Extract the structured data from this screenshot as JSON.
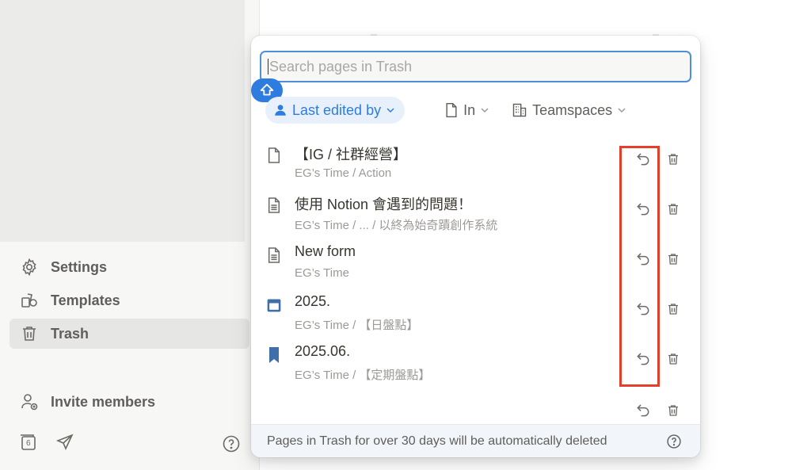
{
  "sidebar": {
    "items": [
      {
        "label": "Settings",
        "icon": "gear-icon"
      },
      {
        "label": "Templates",
        "icon": "templates-icon"
      },
      {
        "label": "Trash",
        "icon": "trash-icon",
        "active": true
      },
      {
        "label": "Invite members",
        "icon": "add-user-icon"
      }
    ],
    "bottom_icons": [
      "calendar-icon",
      "send-icon",
      "help-icon"
    ],
    "calendar_day": "6"
  },
  "trash_popup": {
    "search": {
      "placeholder": "Search pages in Trash",
      "value": ""
    },
    "filters": [
      {
        "label": "Last edited by",
        "icon": "person-icon",
        "active": true
      },
      {
        "label": "In",
        "icon": "page-icon"
      },
      {
        "label": "Teamspaces",
        "icon": "building-icon"
      }
    ],
    "pages": [
      {
        "title": "【IG / 社群經營】",
        "path": "EG’s Time / Action",
        "icon": "page-icon"
      },
      {
        "title": "使用 Notion 會遇到的問題！",
        "path": "EG’s Time / ... / 以終為始奇蹟創作系統",
        "icon": "doc-lines-icon"
      },
      {
        "title": "New form",
        "path": "EG’s Time",
        "icon": "doc-lines-icon"
      },
      {
        "title": "2025.",
        "path": "EG’s Time / 【日盤點】",
        "icon": "calendar-icon"
      },
      {
        "title": "2025.06.",
        "path": "EG’s Time / 【定期盤點】",
        "icon": "bookmark-icon"
      }
    ],
    "footer_text": "Pages in Trash for over 30 days will be automatically deleted"
  },
  "colors": {
    "accent": "#2e7ce0",
    "highlight_box": "#e2402a",
    "sidebar_bg": "#f7f7f5"
  }
}
